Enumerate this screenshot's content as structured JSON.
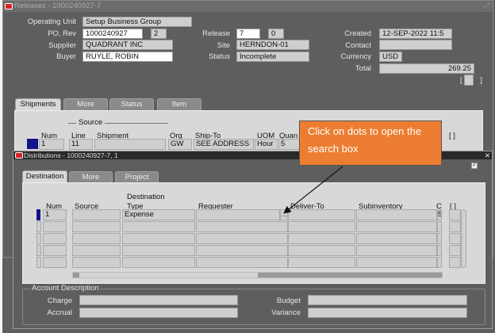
{
  "releases": {
    "title": "Releases - 1000240927-7",
    "operating_unit_label": "Operating Unit",
    "operating_unit": "Setup Business Group",
    "po_rev_label": "PO, Rev",
    "po": "1000240927",
    "rev": "2",
    "release_label": "Release",
    "release": "7",
    "release_rev": "0",
    "created_label": "Created",
    "created": "12-SEP-2022 11:5",
    "supplier_label": "Supplier",
    "supplier": "QUADRANT INC",
    "site_label": "Site",
    "site": "HERNDON-01",
    "contact_label": "Contact",
    "contact": "",
    "buyer_label": "Buyer",
    "buyer": "RUYLE, ROBIN",
    "status_label": "Status",
    "status": "Incomplete",
    "currency_label": "Currency",
    "currency": "USD",
    "total_label": "Total",
    "total": "269.25",
    "bracket": "[ ]",
    "tabs": [
      "Shipments",
      "More",
      "Status",
      "Item"
    ],
    "source_group": "Source",
    "shipment_headers": {
      "num": "Num",
      "line": "Line",
      "shipment": "Shipment",
      "org": "Org",
      "ship_to": "Ship-To",
      "uom": "UOM",
      "quantity": "Quan",
      "bracket": "[ ]"
    },
    "shipment_row": {
      "num": "1",
      "line": "11",
      "shipment": "",
      "org": "GW",
      "ship_to": "SEE ADDRESS",
      "uom": "Hour",
      "quantity": "5"
    }
  },
  "distributions": {
    "title": "Distributions - 1000240927-7, 1",
    "tabs": [
      "Destination",
      "More",
      "Project"
    ],
    "headers": {
      "num": "Num",
      "source": "Source",
      "dest_type_top": "Destination",
      "dest_type": "Type",
      "requester": "Requester",
      "deliver_to": "Deliver-To",
      "subinventory": "Subinventory",
      "next": "C",
      "bracket": "[ ]"
    },
    "row": {
      "num": "1",
      "source": "",
      "dest_type": "Expense",
      "requester": "",
      "dots": "...",
      "deliver_to": "",
      "subinventory": "",
      "next": "5"
    },
    "account_group": "Account Description",
    "charge_label": "Charge",
    "budget_label": "Budget",
    "accrual_label": "Accrual",
    "variance_label": "Variance"
  },
  "callout": {
    "text": "Click on dots to open the search box",
    "color": "#ed7d31"
  }
}
